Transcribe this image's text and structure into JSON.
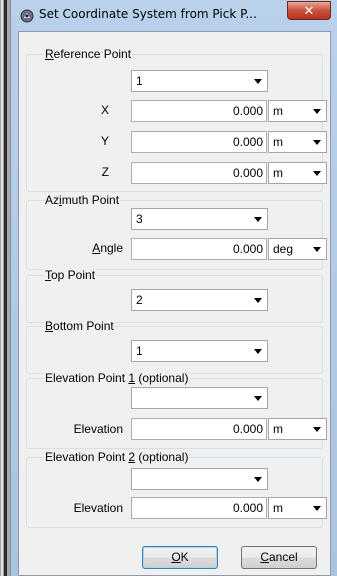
{
  "window": {
    "title": "Set Coordinate System from Pick P..."
  },
  "reference_point": {
    "title_key": "R",
    "title_rest": "eference Point",
    "point_value": "1",
    "x_label": "X",
    "x_value": "0.000",
    "x_unit": "m",
    "y_label": "Y",
    "y_value": "0.000",
    "y_unit": "m",
    "z_label": "Z",
    "z_value": "0.000",
    "z_unit": "m"
  },
  "azimuth_point": {
    "title_pre": "Az",
    "title_key": "i",
    "title_rest": "muth Point",
    "point_value": "3",
    "angle_key": "A",
    "angle_rest": "ngle",
    "angle_value": "0.000",
    "angle_unit": "deg"
  },
  "top_point": {
    "title_key": "T",
    "title_rest": "op Point",
    "point_value": "2"
  },
  "bottom_point": {
    "title_key": "B",
    "title_rest": "ottom Point",
    "point_value": "1"
  },
  "elevation_point_1": {
    "title_pre": "Elevation Point ",
    "title_key": "1",
    "title_rest": " (optional)",
    "point_value": "",
    "elevation_label": "Elevation",
    "elevation_value": "0.000",
    "elevation_unit": "m"
  },
  "elevation_point_2": {
    "title_pre": "Elevation Point ",
    "title_key": "2",
    "title_rest": " (optional)",
    "point_value": "",
    "elevation_label": "Elevation",
    "elevation_value": "0.000",
    "elevation_unit": "m"
  },
  "buttons": {
    "ok_key": "O",
    "ok_rest": "K",
    "cancel_key": "C",
    "cancel_rest": "ancel"
  }
}
